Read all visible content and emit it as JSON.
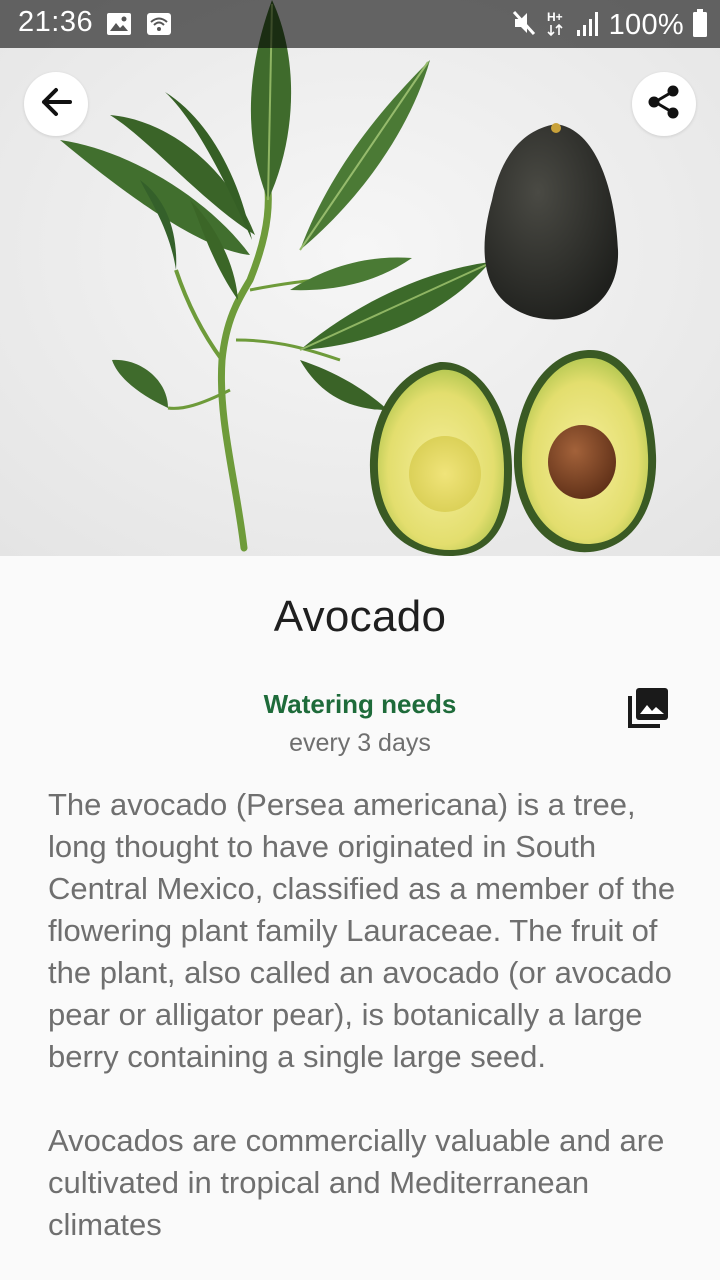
{
  "status_bar": {
    "time": "21:36",
    "battery": "100%",
    "network_type": "H+",
    "left_icons": [
      "image-icon",
      "wifi-icon"
    ],
    "right_icons": [
      "mute-icon",
      "network-hplus-icon",
      "signal-icon",
      "battery-icon"
    ]
  },
  "header": {
    "back_icon": "arrow-left-icon",
    "share_icon": "share-icon"
  },
  "plant": {
    "name": "Avocado",
    "watering_label": "Watering needs",
    "watering_value": "every 3 days",
    "gallery_icon": "photo-library-icon",
    "description_paragraphs": [
      "The avocado (Persea americana) is a tree, long thought to have originated in South Central Mexico, classified as a member of the flowering plant family Lauraceae. The fruit of the plant, also called an avocado (or avocado pear or alligator pear), is botanically a large berry containing a single large seed.",
      "Avocados are commercially valuable and are cultivated in tropical and Mediterranean climates"
    ]
  },
  "colors": {
    "accent_green": "#1e6b3a",
    "text_primary": "#1f1f1f",
    "text_secondary": "#6f6f6f",
    "background": "#fafafa"
  }
}
